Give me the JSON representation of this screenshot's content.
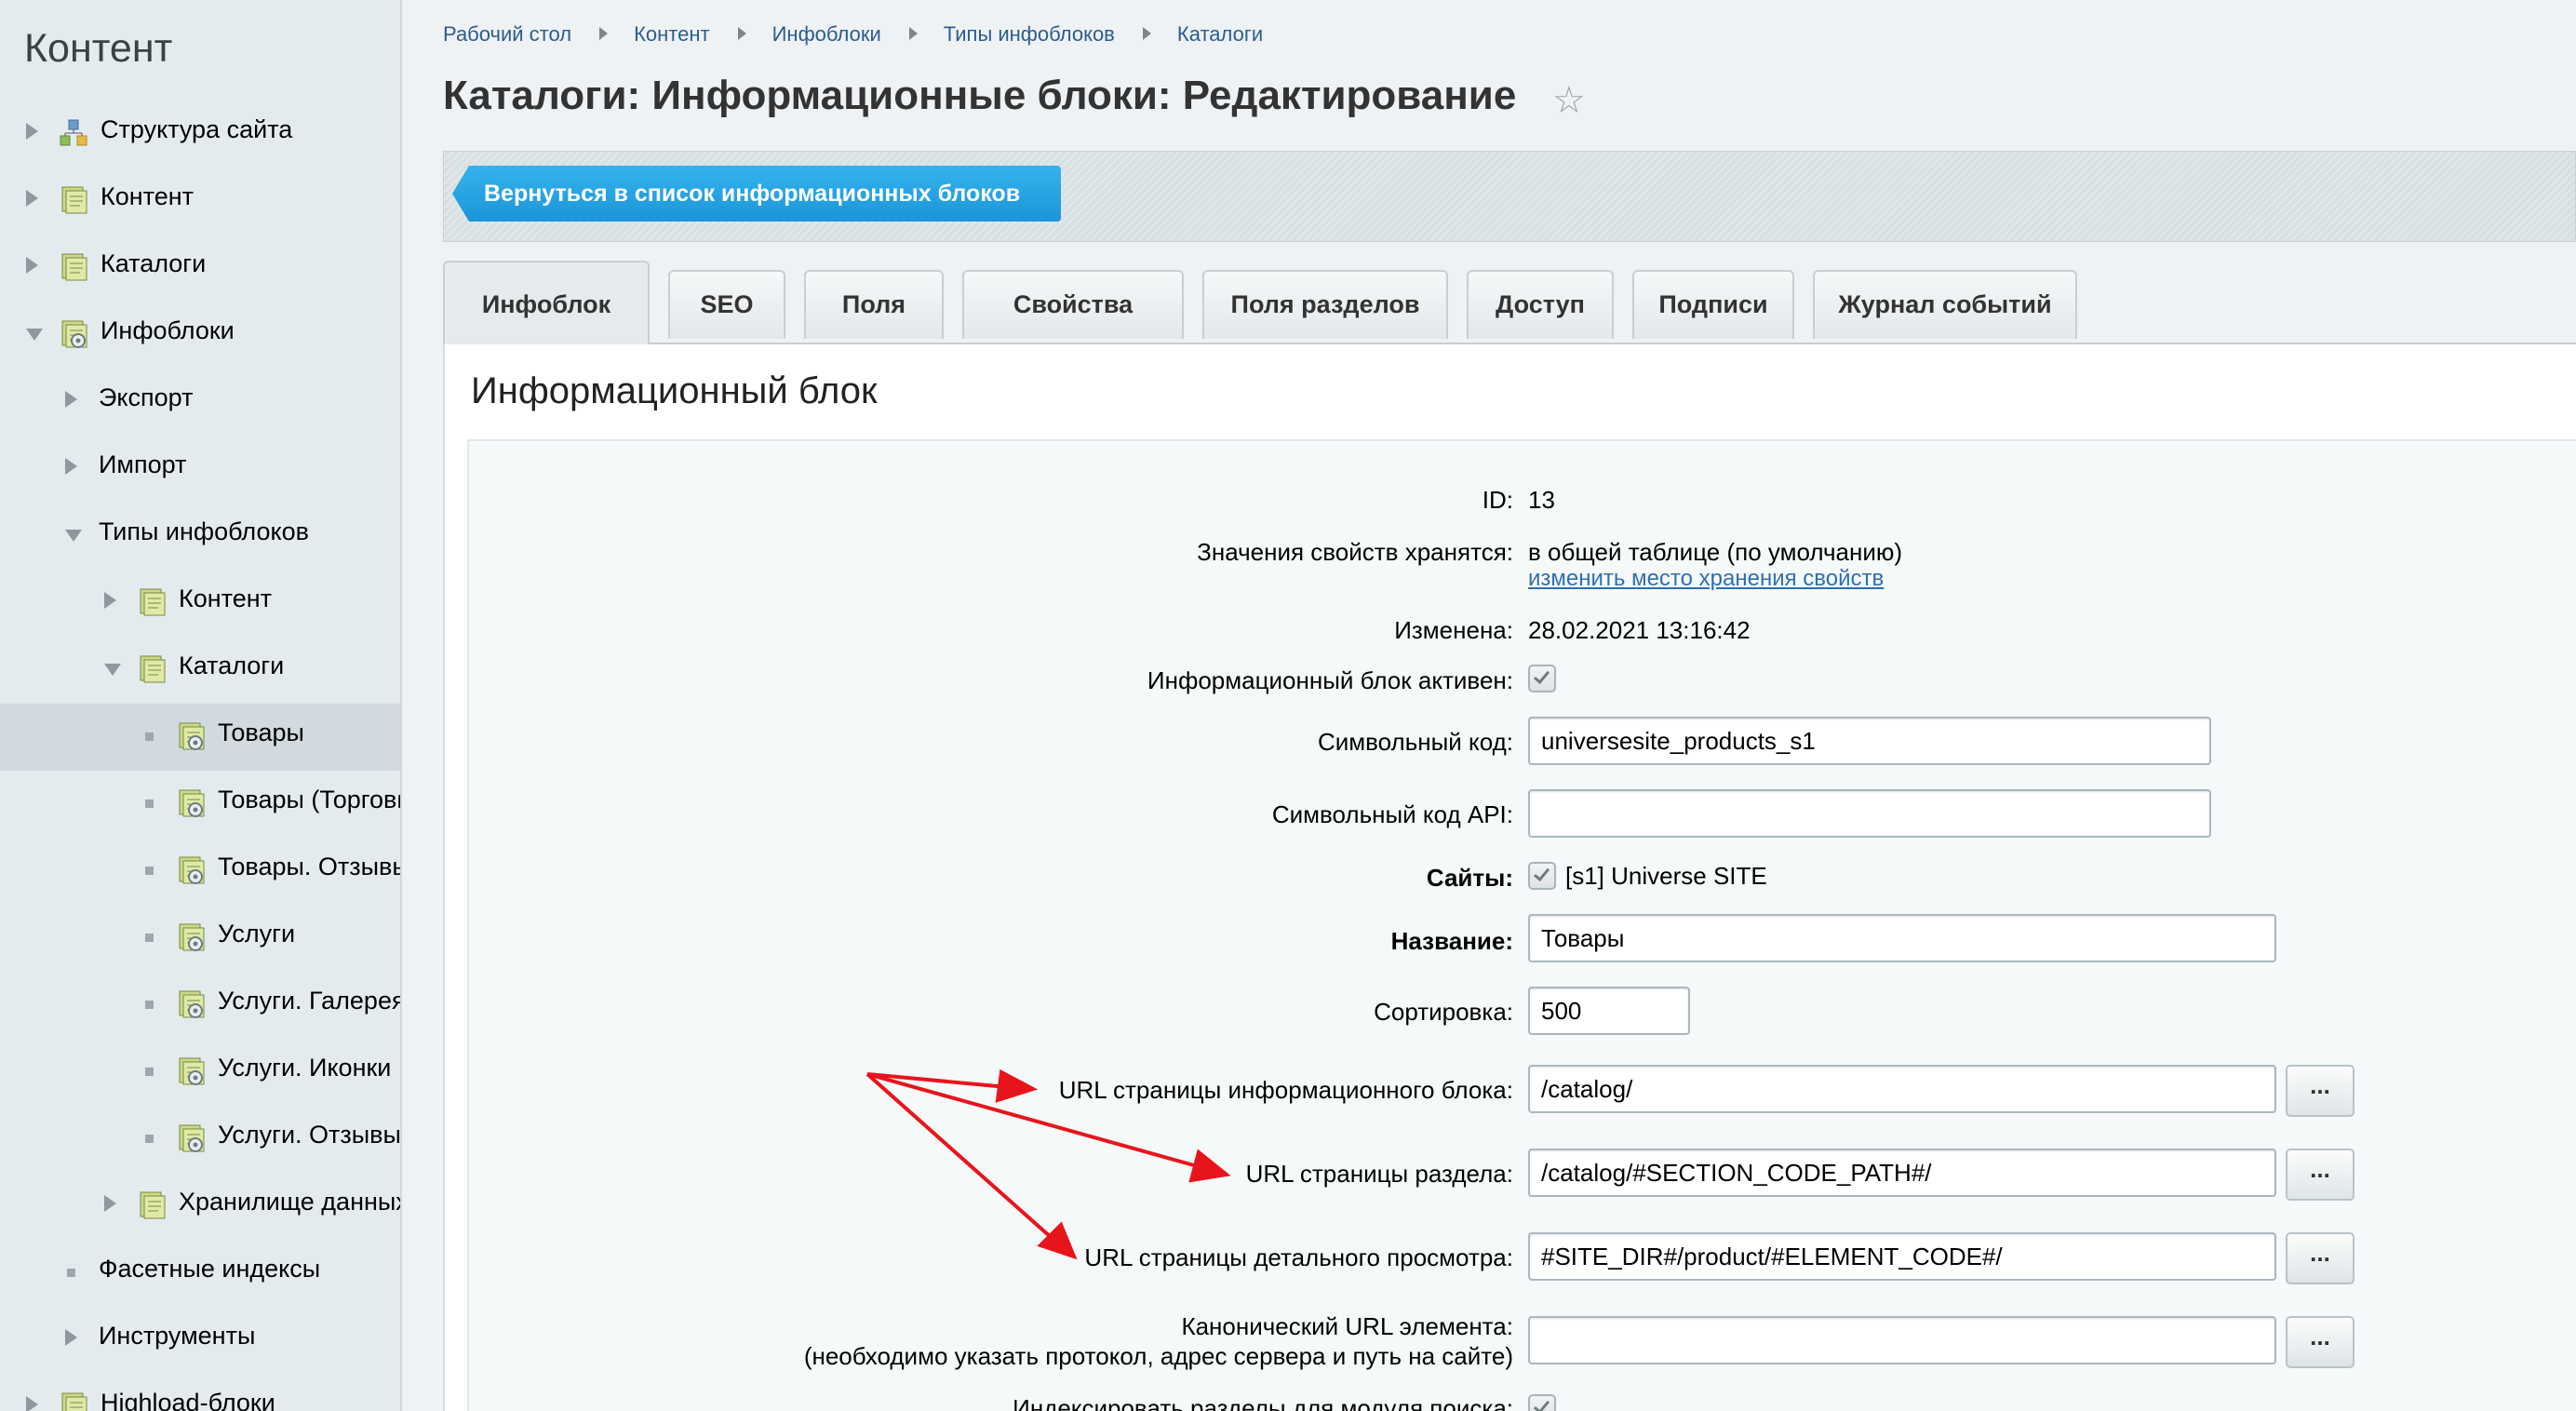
{
  "sidebar": {
    "title": "Контент",
    "items": [
      {
        "label": "Структура сайта",
        "arrow": "right",
        "icon": "site-structure-icon"
      },
      {
        "label": "Контент",
        "arrow": "right",
        "icon": "iblock-icon"
      },
      {
        "label": "Каталоги",
        "arrow": "right",
        "icon": "iblock-icon"
      },
      {
        "label": "Инфоблоки",
        "arrow": "down",
        "icon": "iblock-settings-icon"
      },
      {
        "label": "Экспорт",
        "arrow": "right"
      },
      {
        "label": "Импорт",
        "arrow": "right"
      },
      {
        "label": "Типы инфоблоков",
        "arrow": "down"
      },
      {
        "label": "Контент",
        "arrow": "right",
        "icon": "iblock-icon"
      },
      {
        "label": "Каталоги",
        "arrow": "down",
        "icon": "iblock-icon"
      },
      {
        "label": "Товары",
        "bullet": true,
        "icon": "iblock-settings-icon",
        "selected": true
      },
      {
        "label": "Товары (Торговые предложения)",
        "bullet": true,
        "icon": "iblock-settings-icon"
      },
      {
        "label": "Товары. Отзывы",
        "bullet": true,
        "icon": "iblock-settings-icon"
      },
      {
        "label": "Услуги",
        "bullet": true,
        "icon": "iblock-settings-icon"
      },
      {
        "label": "Услуги. Галерея",
        "bullet": true,
        "icon": "iblock-settings-icon"
      },
      {
        "label": "Услуги. Иконки",
        "bullet": true,
        "icon": "iblock-settings-icon"
      },
      {
        "label": "Услуги. Отзывы",
        "bullet": true,
        "icon": "iblock-settings-icon"
      },
      {
        "label": "Хранилище данных",
        "arrow": "right",
        "icon": "iblock-icon"
      },
      {
        "label": "Фасетные индексы",
        "bullet": true
      },
      {
        "label": "Инструменты",
        "arrow": "right"
      },
      {
        "label": "Highload-блоки",
        "arrow": "right",
        "icon": "iblock-icon"
      }
    ]
  },
  "breadcrumb": [
    "Рабочий стол",
    "Контент",
    "Инфоблоки",
    "Типы инфоблоков",
    "Каталоги"
  ],
  "page_title": "Каталоги: Информационные блоки: Редактирование",
  "star_icon": "star-icon",
  "back_button": "Вернуться в список информационных блоков",
  "tabs": [
    "Инфоблок",
    "SEO",
    "Поля",
    "Свойства",
    "Поля разделов",
    "Доступ",
    "Подписи",
    "Журнал событий"
  ],
  "active_tab": "Инфоблок",
  "section_title": "Информационный блок",
  "form": {
    "id_label": "ID:",
    "id_value": "13",
    "storage_label": "Значения свойств хранятся:",
    "storage_value": "в общей таблице (по умолчанию)",
    "storage_link": "изменить место хранения свойств",
    "modified_label": "Изменена:",
    "modified_value": "28.02.2021 13:16:42",
    "active_label": "Информационный блок активен:",
    "active_checked": true,
    "code_label": "Символьный код:",
    "code_value": "universesite_products_s1",
    "api_code_label": "Символьный код API:",
    "api_code_value": "",
    "sites_label": "Сайты:",
    "sites_value": "[s1] Universe SITE",
    "name_label": "Название:",
    "name_value": "Товары",
    "sort_label": "Сортировка:",
    "sort_value": "500",
    "list_url_label": "URL страницы информационного блока:",
    "list_url_value": "/catalog/",
    "section_url_label": "URL страницы раздела:",
    "section_url_value": "/catalog/#SECTION_CODE_PATH#/",
    "detail_url_label": "URL страницы детального просмотра:",
    "detail_url_value": "#SITE_DIR#/product/#ELEMENT_CODE#/",
    "canonical_label_1": "Канонический URL элемента:",
    "canonical_label_2": "(необходимо указать протокол, адрес сервера и путь на сайте)",
    "canonical_value": "",
    "index_label": "Индексировать разделы для модуля поиска:",
    "dots_label": "..."
  },
  "colors": {
    "annotation_arrow": "#e8141c",
    "back_button": "#1e9ad9",
    "link": "#2f6fb4"
  }
}
